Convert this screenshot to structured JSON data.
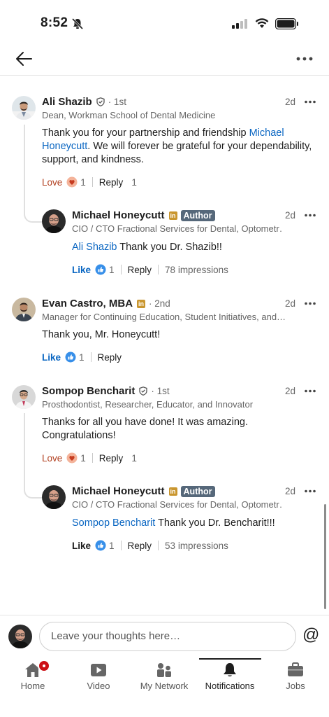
{
  "status": {
    "time": "8:52"
  },
  "comments": [
    {
      "name": "Ali Shazib",
      "degree": "· 1st",
      "headline": "Dean, Workman School of Dental Medicine",
      "time": "2d",
      "body_link": "Michael Honeycutt",
      "body_pre": "Thank you for your partnership and friendship ",
      "body_post": ". We will forever be grateful for your dependability, support, and kindness.",
      "reaction_label": "Love",
      "reaction_count": "1",
      "reply_label": "Reply",
      "reply_count": "1"
    },
    {
      "name": "Michael Honeycutt",
      "badge": "Author",
      "headline": "CIO / CTO Fractional Services for Dental, Optometr…",
      "time": "2d",
      "body_link": "Ali Shazib",
      "body_post": " Thank you Dr. Shazib!!",
      "reaction_label": "Like",
      "reaction_count": "1",
      "reply_label": "Reply",
      "impressions": "78 impressions"
    },
    {
      "name": "Evan Castro, MBA",
      "degree": "· 2nd",
      "headline": "Manager for Continuing Education, Student Initiatives, and…",
      "time": "2d",
      "body": "Thank you, Mr. Honeycutt!",
      "reaction_label": "Like",
      "reaction_count": "1",
      "reply_label": "Reply"
    },
    {
      "name": "Sompop Bencharit",
      "degree": "· 1st",
      "headline": "Prosthodontist, Researcher, Educator, and Innovator",
      "time": "2d",
      "body": "Thanks for all you have done! It was amazing. Congratulations!",
      "reaction_label": "Love",
      "reaction_count": "1",
      "reply_label": "Reply",
      "reply_count": "1"
    },
    {
      "name": "Michael Honeycutt",
      "badge": "Author",
      "headline": "CIO / CTO Fractional Services for Dental, Optometr…",
      "time": "2d",
      "body_link": "Sompop Bencharit",
      "body_post": " Thank you Dr. Bencharit!!!",
      "reaction_label": "Like",
      "reaction_count": "1",
      "reply_label": "Reply",
      "impressions": "53 impressions"
    }
  ],
  "composer": {
    "placeholder": "Leave your thoughts here…",
    "at_symbol": "@"
  },
  "tabs": [
    {
      "label": "Home",
      "icon": "home-icon"
    },
    {
      "label": "Video",
      "icon": "video-icon"
    },
    {
      "label": "My Network",
      "icon": "network-icon"
    },
    {
      "label": "Notifications",
      "icon": "bell-icon",
      "active": true
    },
    {
      "label": "Jobs",
      "icon": "briefcase-icon"
    }
  ],
  "colors": {
    "link": "#0a66c2",
    "love": "#b24020",
    "author_badge": "#56687a",
    "premium_badge": "#c9962f"
  }
}
